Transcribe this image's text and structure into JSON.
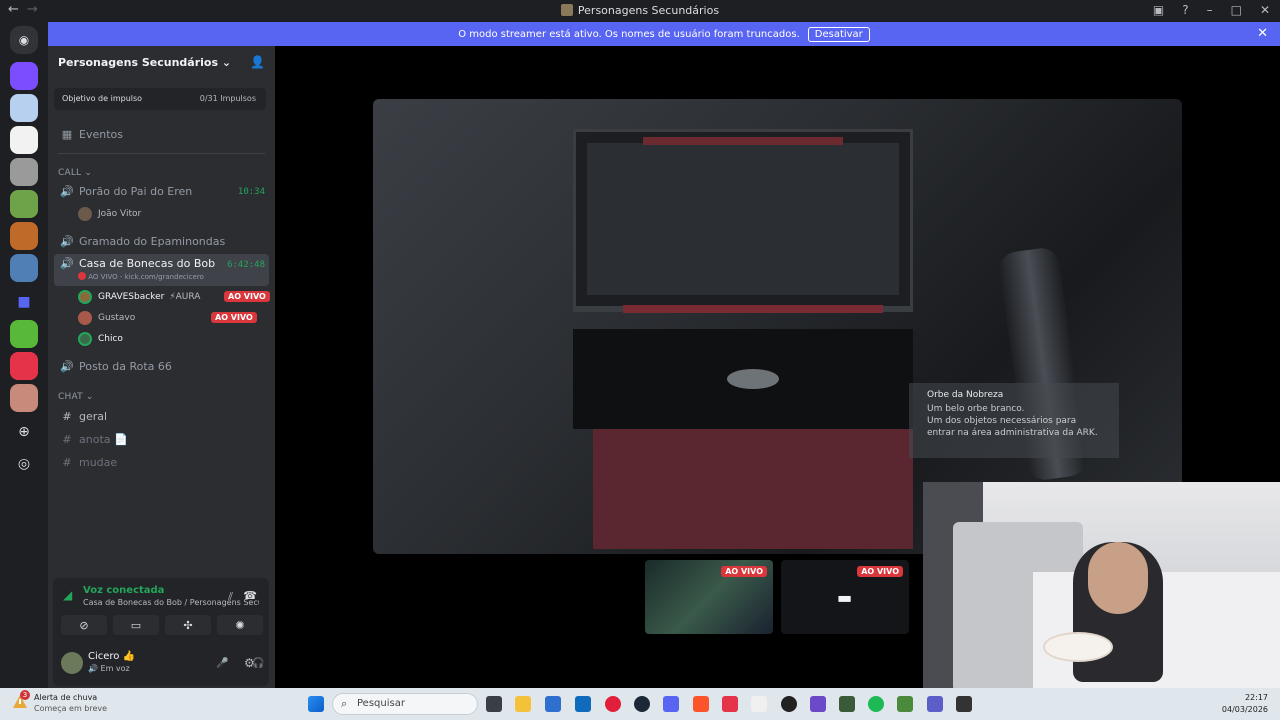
{
  "window": {
    "title": "Personagens Secundários",
    "nav_back": "←",
    "nav_forward": "→"
  },
  "banner": {
    "message": "O modo streamer está ativo. Os nomes de usuário foram truncados.",
    "button": "Desativar"
  },
  "server": {
    "name": "Personagens Secundários",
    "boost_label": "Objetivo de impulso",
    "boost_count": "0/31 Impulsos"
  },
  "events_label": "Eventos",
  "call_category": "CALL",
  "chat_category": "CHAT",
  "voice_channels": [
    {
      "name": "Porão do Pai do Eren",
      "timer": "10:34"
    },
    {
      "name": "Gramado do Epaminondas"
    },
    {
      "name": "Casa de Bonecas do Bob",
      "timer": "6:42:48",
      "status": "AO VIVO - kick.com/grandecicero"
    },
    {
      "name": "Posto da Rota 66"
    }
  ],
  "members": {
    "porao": [
      {
        "name": "João Vitor"
      }
    ],
    "casa": [
      {
        "name": "GRAVESbacker",
        "tag": "AURA",
        "live": "AO VIVO"
      },
      {
        "name": "Gustavo",
        "live": "AO VIVO"
      },
      {
        "name": "Chico"
      }
    ]
  },
  "text_channels": [
    {
      "name": "geral"
    },
    {
      "name": "anota 📄"
    },
    {
      "name": "mudae"
    }
  ],
  "voice_panel": {
    "title": "Voz conectada",
    "subtitle": "Casa de Bonecas do Bob / Personagens Secund..."
  },
  "user": {
    "name": "Cicero 👍",
    "status": "Em voz"
  },
  "stream": {
    "tooltip_title": "Orbe da Nobreza",
    "tooltip_lines": [
      "Um belo orbe branco.",
      "Um dos objetos necessários para",
      "entrar na área administrativa da ARK."
    ],
    "thumb_live_1": "AO VIVO",
    "thumb_live_2": "AO VIVO"
  },
  "taskbar": {
    "weather_title": "Alerta de chuva",
    "weather_sub": "Começa em breve",
    "search_placeholder": "Pesquisar",
    "time": "22:17",
    "date": "04/03/2026",
    "badge": "3"
  },
  "colors": {
    "accent": "#5865f2",
    "live": "#da373c",
    "connected": "#23a55a"
  }
}
